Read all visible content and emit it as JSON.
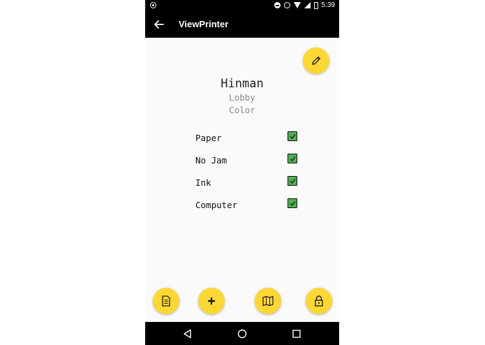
{
  "status_bar": {
    "time": "5:39",
    "icons": [
      "notification-dot-icon",
      "do-not-disturb-icon",
      "alarm-icon",
      "wifi-icon",
      "signal-icon",
      "battery-icon"
    ]
  },
  "app_bar": {
    "title": "ViewPrinter",
    "back_icon": "arrow-left-icon"
  },
  "printer": {
    "name": "Hinman",
    "location": "Lobby",
    "type": "Color"
  },
  "status_items": [
    {
      "label": "Paper",
      "checked": true
    },
    {
      "label": "No Jam",
      "checked": true
    },
    {
      "label": "Ink",
      "checked": true
    },
    {
      "label": "Computer",
      "checked": true
    }
  ],
  "fabs": {
    "edit": "pencil-icon",
    "bottom": [
      "document-icon",
      "plus-icon",
      "map-icon",
      "lock-icon"
    ]
  },
  "nav_bar": {
    "buttons": [
      "triangle-back-icon",
      "circle-home-icon",
      "square-recents-icon"
    ]
  },
  "colors": {
    "accent": "#fdd835",
    "bar": "#000000",
    "check": "#4caf50",
    "background": "#fafafa"
  }
}
